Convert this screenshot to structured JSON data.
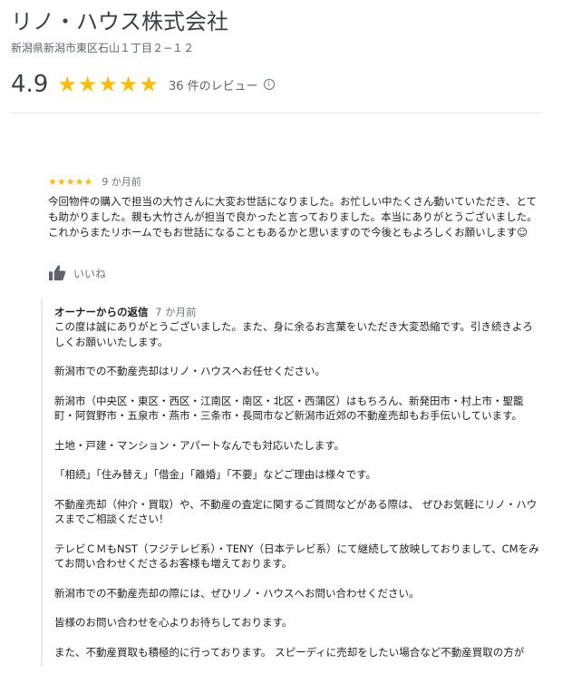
{
  "business": {
    "name": "リノ・ハウス株式会社",
    "address": "新潟県新潟市東区石山１丁目２−１２",
    "rating": "4.9",
    "stars": "★★★★★",
    "review_count": "36 件のレビュー",
    "info_icon": "i"
  },
  "review": {
    "stars": "★★★★★",
    "date": "9 か月前",
    "text": "今回物件の購入で担当の大竹さんに大変お世話になりました。お忙しい中たくさん動いていただき、とても助かりました。親も大竹さんが担当で良かったと言っておりました。本当にありがとうございました。これからまたリホームでもお世話になることもあるかと思いますので今後ともよろしくお願いします☺",
    "like_label": "いいね",
    "icons": {
      "like": "thumbs-up-icon"
    }
  },
  "owner_reply": {
    "title": "オーナーからの返信",
    "date": "7 か月前",
    "paragraphs": [
      "この度は誠にありがとうございました。また、身に余るお言葉をいただき大変恐縮です。引き続きよろしくお願いいたします。",
      "新潟市での不動産売却はリノ・ハウスへお任せください。",
      "新潟市（中央区・東区・西区・江南区・南区・北区・西蒲区）はもちろん、新発田市・村上市・聖籠町・阿賀野市・五泉市・燕市・三条市・長岡市など新潟市近郊の不動産売却もお手伝いしています。",
      "土地・戸建・マンション・アパートなんでも対応いたします。",
      "「相続」「住み替え」「借金」「離婚」「不要」などご理由は様々です。",
      "不動産売却（仲介・買取）や、不動産の査定に関するご質問などがある際は、 ぜひお気軽にリノ・ハウスまでご相談ください！",
      "テレビＣＭもNST（フジテレビ系）・TENY（日本テレビ系）にて継続して放映しておりまして、CMをみてお問い合わせくださるお客様も増えております。",
      "新潟市での不動産売却の際には、ぜひリノ・ハウスへお問い合わせください。",
      "皆様のお問い合わせを心よりお待ちしております。",
      "また、不動産買取も積極的に行っております。 スピーディに売却をしたい場合など不動産買取の方が"
    ]
  },
  "colors": {
    "star": "#fbbc04",
    "muted": "#70757a",
    "divider": "#e8eaed"
  }
}
